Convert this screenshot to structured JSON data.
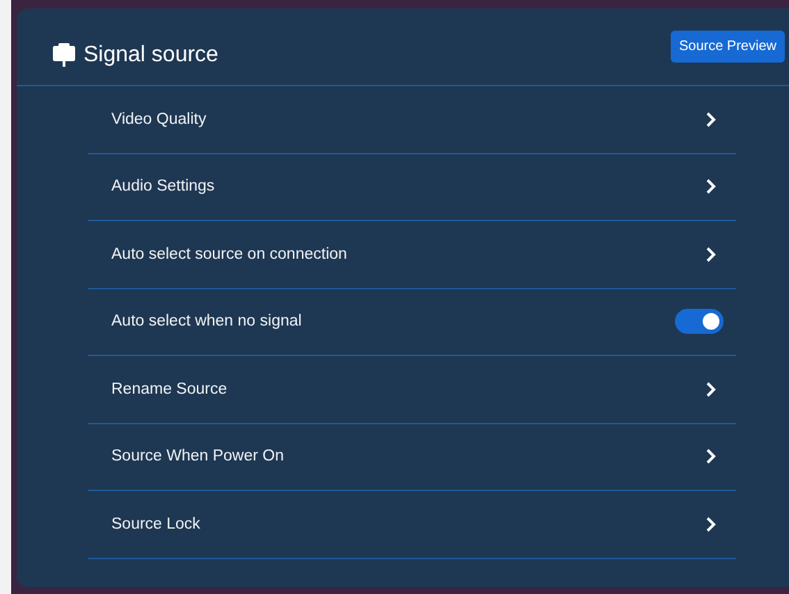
{
  "panel": {
    "title": "Signal source",
    "button": "Source Preview"
  },
  "rows": [
    {
      "label": "Video Quality",
      "kind": "link"
    },
    {
      "label": "Audio Settings",
      "kind": "link"
    },
    {
      "label": "Auto select source on connection",
      "kind": "link"
    },
    {
      "label": "Auto select when no signal",
      "kind": "toggle",
      "on": true
    },
    {
      "label": "Rename Source",
      "kind": "link"
    },
    {
      "label": "Source When Power On",
      "kind": "link"
    },
    {
      "label": "Source Lock",
      "kind": "link"
    }
  ]
}
